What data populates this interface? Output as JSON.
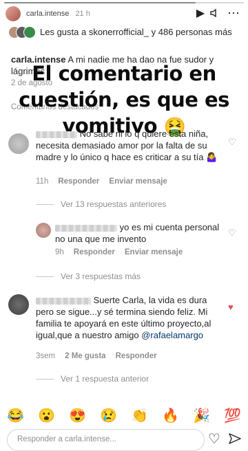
{
  "story": {
    "username": "carla.intense",
    "time": "21 h",
    "progress": 0.8
  },
  "post": {
    "likes_text": "Les gusta a skonerrofficial_ y 486 personas más",
    "caption_user": "carla.intense",
    "caption_text": "A mi nadie me ha dao na fue sudor y lágrimas",
    "date": "2 de agosto",
    "featured_label": "Comentarios destacados"
  },
  "overlay": {
    "line1": "El comentario en",
    "line2": "cuestión, es que es",
    "line3": "vomitivo",
    "emoji": "🤮"
  },
  "comments": [
    {
      "text": "No sabe ni lo q quiere esta niña, necesita demasiado amor por la falta de su madre y lo único q hace es criticar a su tía 🤷‍♀️",
      "time": "11h",
      "reply": "Responder",
      "send": "Enviar mensaje",
      "liked": false
    },
    {
      "text": "yo es mi cuenta personal no una que me invento",
      "time": "9h",
      "reply": "Responder",
      "send": "Enviar mensaje",
      "liked": false
    },
    {
      "text": "Suerte Carla, la vida es dura pero se sigue...y sé termina siendo feliz. Mi familia te apoyará en este último proyecto,al igual,que a nuestro amigo",
      "mention": "@rafaelamargo",
      "time": "3sem",
      "likes": "2 Me gusta",
      "reply": "Responder",
      "liked": true
    }
  ],
  "thread_links": {
    "first": "Ver 13 respuestas anteriores",
    "second": "Ver 3 respuestas más",
    "third": "Ver 1 respuesta anterior"
  },
  "reactions": [
    "😂",
    "😮",
    "😍",
    "😢",
    "👏",
    "🔥",
    "🎉",
    "💯"
  ],
  "reply_placeholder": "Responder a carla.intense..."
}
